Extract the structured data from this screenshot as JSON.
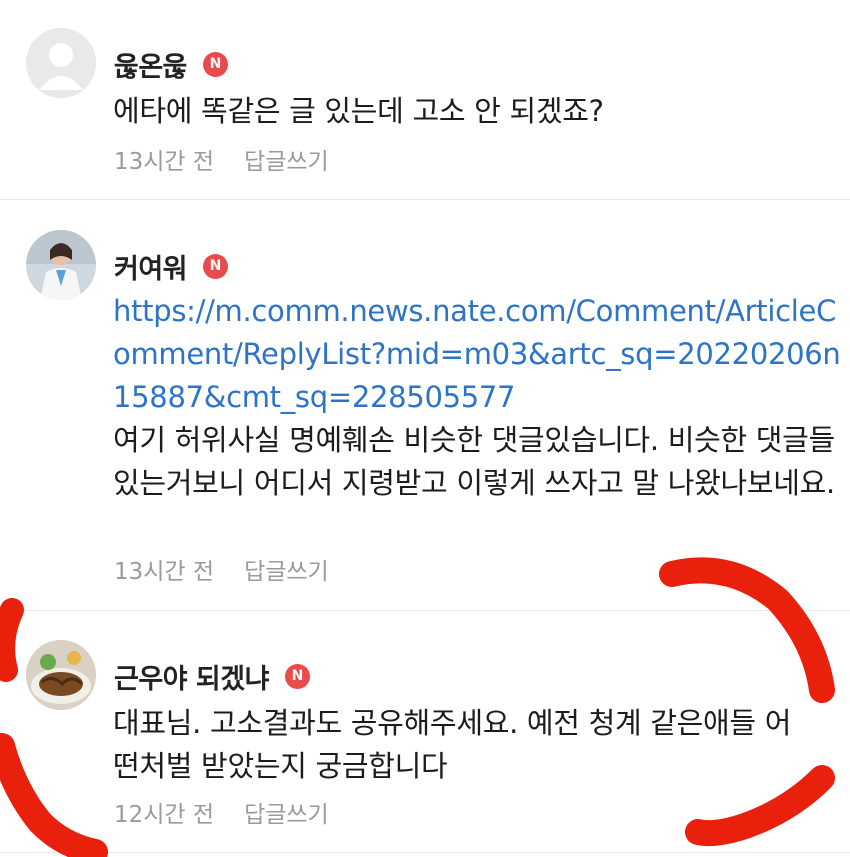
{
  "comments": [
    {
      "author": "욶온욶",
      "badge": "N",
      "text": "에타에 똑같은 글 있는데 고소 안 되겠죠?",
      "time": "13시간 전",
      "reply": "답글쓰기"
    },
    {
      "author": "커여워",
      "badge": "N",
      "link": "https://m.comm.news.nate.com/Comment/ArticleComment/ReplyList?mid=m03&artc_sq=20220206n15887&cmt_sq=228505577",
      "text": "여기 허위사실 명예훼손 비슷한 댓글있습니다. 비슷한 댓글들 있는거보니 어디서 지령받고 이렇게 쓰자고 말 나왔나보네요.",
      "time": "13시간 전",
      "reply": "답글쓰기"
    },
    {
      "author": "근우야 되겠냐",
      "badge": "N",
      "text": "대표님. 고소결과도 공유해주세요. 예전 청계 같은애들 어떤처벌 받았는지 궁금합니다",
      "time": "12시간 전",
      "reply": "답글쓰기"
    }
  ],
  "colors": {
    "badge": "#e94a4a",
    "link": "#2d74c9",
    "meta": "#9a9a9a",
    "scribble": "#e8200c"
  }
}
